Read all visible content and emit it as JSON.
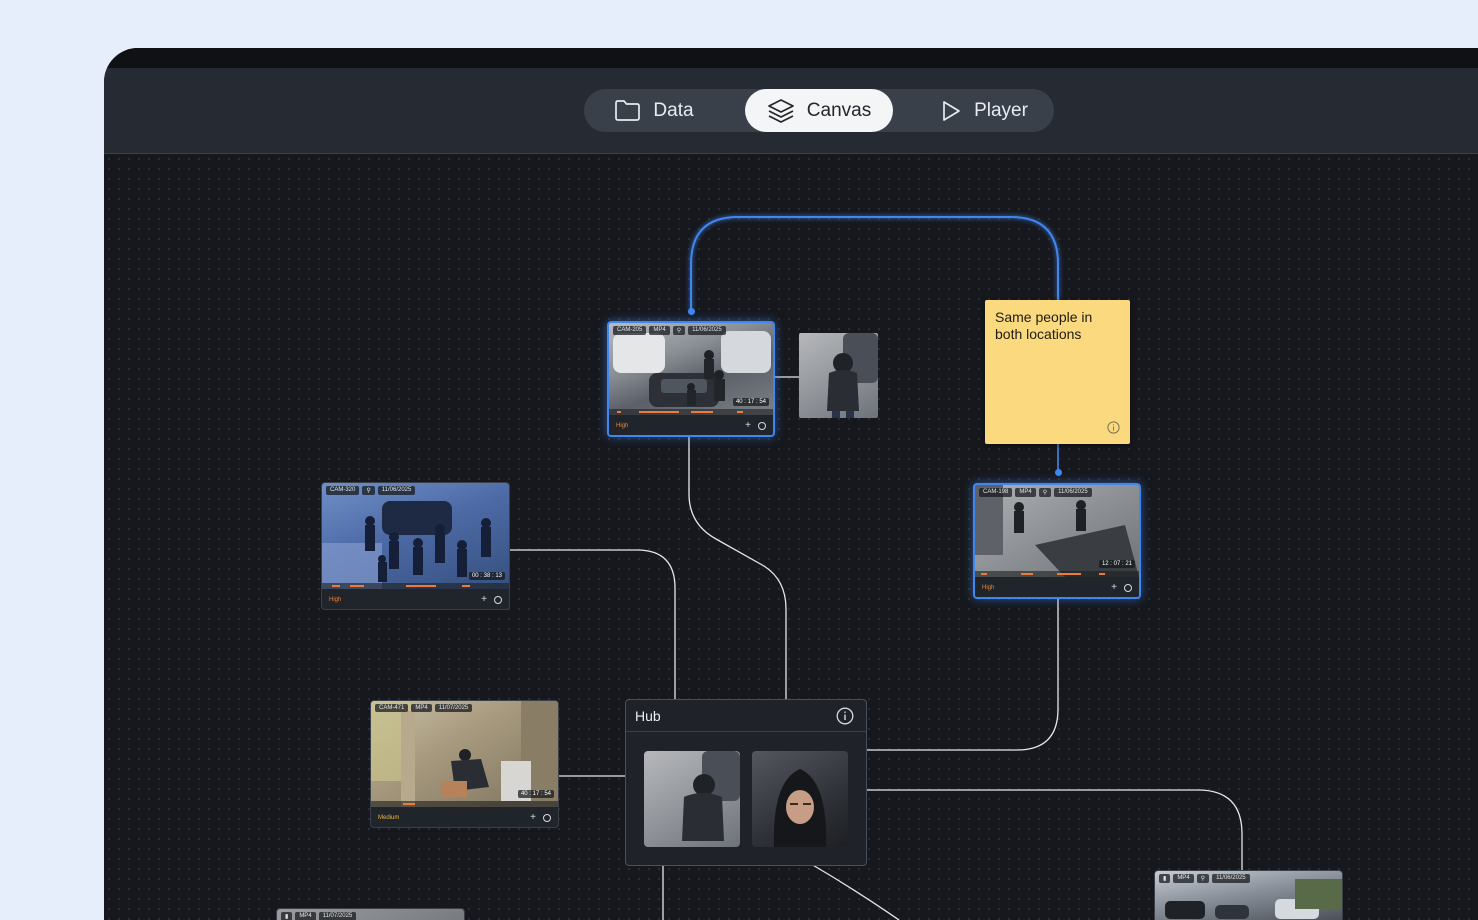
{
  "toolbar": {
    "tabs": [
      {
        "label": "Data",
        "icon": "folder-icon",
        "active": false
      },
      {
        "label": "Canvas",
        "icon": "layers-icon",
        "active": true
      },
      {
        "label": "Player",
        "icon": "play-icon",
        "active": false
      }
    ]
  },
  "colors": {
    "accent": "#3f86f0",
    "note": "#fbd97f",
    "level_high": "#f0853c",
    "level_medium": "#f0b43c"
  },
  "cards": {
    "cam205": {
      "camera": "CAM-205",
      "format": "MP4",
      "date": "11/06/2025",
      "timecode": "40 : 17 : 54",
      "level": "High"
    },
    "cam320": {
      "camera": "CAM-320",
      "date": "11/06/2025",
      "timecode": "00 : 38 : 13",
      "level": "High"
    },
    "cam198": {
      "camera": "CAM-198",
      "format": "MP4",
      "date": "11/06/2025",
      "timecode": "12 : 07 : 21",
      "level": "High"
    },
    "cam471": {
      "camera": "CAM-471",
      "format": "MP4",
      "date": "11/07/2025",
      "timecode": "40 : 17 : 54",
      "level": "Medium"
    },
    "bottom_left": {
      "format": "MP4",
      "date": "11/07/2025"
    },
    "bottom_right": {
      "format": "MP4",
      "date": "11/06/2025"
    }
  },
  "note": {
    "text": "Same people in both locations"
  },
  "hub": {
    "title": "Hub"
  }
}
